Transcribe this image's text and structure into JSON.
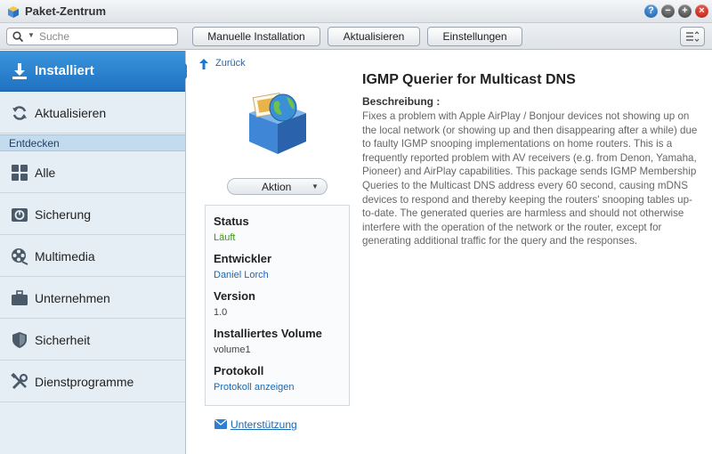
{
  "window": {
    "title": "Paket-Zentrum",
    "buttons": {
      "help": "?",
      "minimize": "−",
      "maximize": "+",
      "close": "×"
    }
  },
  "toolbar": {
    "search_placeholder": "Suche",
    "manual_install": "Manuelle Installation",
    "update": "Aktualisieren",
    "settings": "Einstellungen"
  },
  "sidebar": {
    "items": [
      {
        "label": "Installiert",
        "icon": "download-icon",
        "active": true
      },
      {
        "label": "Aktualisieren",
        "icon": "refresh-icon",
        "active": false
      }
    ],
    "section_label": "Entdecken",
    "discover_items": [
      {
        "label": "Alle",
        "icon": "grid-icon"
      },
      {
        "label": "Sicherung",
        "icon": "backup-icon"
      },
      {
        "label": "Multimedia",
        "icon": "film-reel-icon"
      },
      {
        "label": "Unternehmen",
        "icon": "briefcase-icon"
      },
      {
        "label": "Sicherheit",
        "icon": "shield-icon"
      },
      {
        "label": "Dienstprogramme",
        "icon": "tools-icon"
      }
    ]
  },
  "main": {
    "back_label": "Zurück",
    "action_label": "Aktion",
    "package_title": "IGMP Querier for Multicast DNS",
    "description_heading": "Beschreibung :",
    "description": "Fixes a problem with Apple AirPlay / Bonjour devices not showing up on the local network (or showing up and then disappearing after a while) due to faulty IGMP snooping implementations on home routers. This is a frequently reported problem with AV receivers (e.g. from Denon, Yamaha, Pioneer) and AirPlay capabilities. This package sends IGMP Membership Queries to the Multicast DNS address every 60 second, causing mDNS devices to respond and thereby keeping the routers' snooping tables up-to-date. The generated queries are harmless and should not otherwise interfere with the operation of the network or the router, except for generating additional traffic for the query and the responses.",
    "info": {
      "status_label": "Status",
      "status_value": "Läuft",
      "developer_label": "Entwickler",
      "developer_value": "Daniel Lorch",
      "version_label": "Version",
      "version_value": "1.0",
      "volume_label": "Installiertes Volume",
      "volume_value": "volume1",
      "log_label": "Protokoll",
      "log_value": "Protokoll anzeigen"
    },
    "support_label": "Unterstützung"
  },
  "colors": {
    "accent": "#2a80cd",
    "status_running": "#3a9a15",
    "link": "#1a68b5",
    "sidebar_bg": "#e6eef5"
  }
}
